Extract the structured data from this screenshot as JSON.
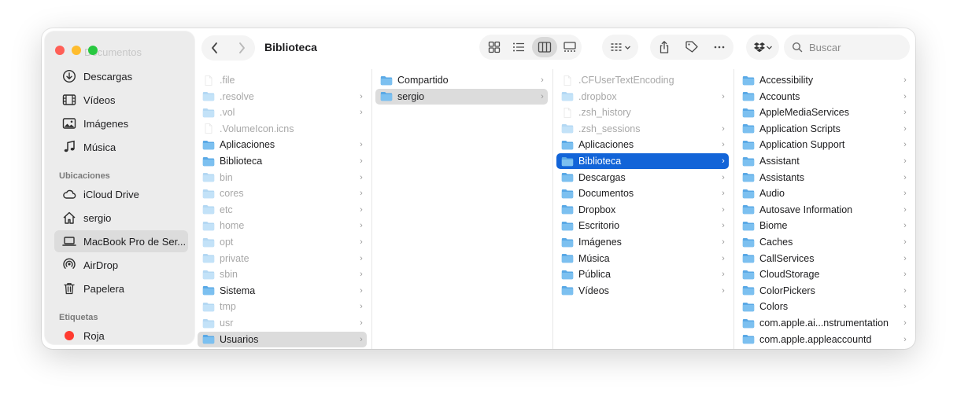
{
  "window": {
    "title": "Biblioteca",
    "ghost_text": "Documentos"
  },
  "toolbar": {
    "back_label": "‹",
    "forward_label": "›",
    "search_placeholder": "Buscar",
    "view_icons": [
      "grid-view-icon",
      "list-view-icon",
      "columns-view-icon",
      "gallery-view-icon"
    ],
    "active_view": "columns"
  },
  "sidebar": {
    "favorites": [
      {
        "label": "Descargas",
        "icon": "download-icon"
      },
      {
        "label": "Vídeos",
        "icon": "film-icon"
      },
      {
        "label": "Imágenes",
        "icon": "photo-icon"
      },
      {
        "label": "Música",
        "icon": "music-note-icon"
      }
    ],
    "locations_header": "Ubicaciones",
    "locations": [
      {
        "label": "iCloud Drive",
        "icon": "cloud-icon"
      },
      {
        "label": "sergio",
        "icon": "house-icon"
      },
      {
        "label": "MacBook Pro de Ser...",
        "icon": "laptop-icon",
        "selected": true
      },
      {
        "label": "AirDrop",
        "icon": "airdrop-icon"
      },
      {
        "label": "Papelera",
        "icon": "trash-icon"
      }
    ],
    "tags_header": "Etiquetas",
    "tags": [
      {
        "label": "Roja",
        "color": "#ff3b30"
      }
    ]
  },
  "columns": [
    {
      "items": [
        {
          "name": ".file",
          "kind": "file",
          "dim": true,
          "chevron": false
        },
        {
          "name": ".resolve",
          "kind": "folder",
          "dim": true,
          "chevron": true
        },
        {
          "name": ".vol",
          "kind": "folder",
          "dim": true,
          "chevron": true
        },
        {
          "name": ".VolumeIcon.icns",
          "kind": "file",
          "dim": true,
          "chevron": false
        },
        {
          "name": "Aplicaciones",
          "kind": "folder",
          "dim": false,
          "chevron": true
        },
        {
          "name": "Biblioteca",
          "kind": "folder",
          "dim": false,
          "chevron": true
        },
        {
          "name": "bin",
          "kind": "folder",
          "dim": true,
          "chevron": true
        },
        {
          "name": "cores",
          "kind": "folder",
          "dim": true,
          "chevron": true
        },
        {
          "name": "etc",
          "kind": "folder",
          "dim": true,
          "chevron": true
        },
        {
          "name": "home",
          "kind": "folder",
          "dim": true,
          "chevron": true
        },
        {
          "name": "opt",
          "kind": "folder",
          "dim": true,
          "chevron": true
        },
        {
          "name": "private",
          "kind": "folder",
          "dim": true,
          "chevron": true
        },
        {
          "name": "sbin",
          "kind": "folder",
          "dim": true,
          "chevron": true
        },
        {
          "name": "Sistema",
          "kind": "folder",
          "dim": false,
          "chevron": true
        },
        {
          "name": "tmp",
          "kind": "folder",
          "dim": true,
          "chevron": true
        },
        {
          "name": "usr",
          "kind": "folder",
          "dim": true,
          "chevron": true
        },
        {
          "name": "Usuarios",
          "kind": "folder",
          "dim": false,
          "chevron": true,
          "selected": "gray"
        }
      ]
    },
    {
      "items": [
        {
          "name": "Compartido",
          "kind": "folder",
          "dim": false,
          "chevron": true
        },
        {
          "name": "sergio",
          "kind": "folder",
          "dim": false,
          "chevron": true,
          "selected": "gray"
        }
      ]
    },
    {
      "items": [
        {
          "name": ".CFUserTextEncoding",
          "kind": "file",
          "dim": true,
          "chevron": false
        },
        {
          "name": ".dropbox",
          "kind": "folder",
          "dim": true,
          "chevron": true
        },
        {
          "name": ".zsh_history",
          "kind": "file",
          "dim": true,
          "chevron": false
        },
        {
          "name": ".zsh_sessions",
          "kind": "folder",
          "dim": true,
          "chevron": true
        },
        {
          "name": "Aplicaciones",
          "kind": "folder",
          "dim": false,
          "chevron": true
        },
        {
          "name": "Biblioteca",
          "kind": "folder",
          "dim": false,
          "chevron": true,
          "selected": "blue"
        },
        {
          "name": "Descargas",
          "kind": "folder",
          "dim": false,
          "chevron": true
        },
        {
          "name": "Documentos",
          "kind": "folder",
          "dim": false,
          "chevron": true
        },
        {
          "name": "Dropbox",
          "kind": "folder",
          "dim": false,
          "chevron": true
        },
        {
          "name": "Escritorio",
          "kind": "folder",
          "dim": false,
          "chevron": true
        },
        {
          "name": "Imágenes",
          "kind": "folder",
          "dim": false,
          "chevron": true
        },
        {
          "name": "Música",
          "kind": "folder",
          "dim": false,
          "chevron": true
        },
        {
          "name": "Pública",
          "kind": "folder",
          "dim": false,
          "chevron": true
        },
        {
          "name": "Vídeos",
          "kind": "folder",
          "dim": false,
          "chevron": true
        }
      ]
    },
    {
      "items": [
        {
          "name": "Accessibility",
          "kind": "folder",
          "dim": false,
          "chevron": true
        },
        {
          "name": "Accounts",
          "kind": "folder",
          "dim": false,
          "chevron": true
        },
        {
          "name": "AppleMediaServices",
          "kind": "folder",
          "dim": false,
          "chevron": true
        },
        {
          "name": "Application Scripts",
          "kind": "folder",
          "dim": false,
          "chevron": true
        },
        {
          "name": "Application Support",
          "kind": "folder",
          "dim": false,
          "chevron": true
        },
        {
          "name": "Assistant",
          "kind": "folder",
          "dim": false,
          "chevron": true
        },
        {
          "name": "Assistants",
          "kind": "folder",
          "dim": false,
          "chevron": true
        },
        {
          "name": "Audio",
          "kind": "folder",
          "dim": false,
          "chevron": true
        },
        {
          "name": "Autosave Information",
          "kind": "folder",
          "dim": false,
          "chevron": true
        },
        {
          "name": "Biome",
          "kind": "folder",
          "dim": false,
          "chevron": true
        },
        {
          "name": "Caches",
          "kind": "folder",
          "dim": false,
          "chevron": true
        },
        {
          "name": "CallServices",
          "kind": "folder",
          "dim": false,
          "chevron": true
        },
        {
          "name": "CloudStorage",
          "kind": "folder",
          "dim": false,
          "chevron": true
        },
        {
          "name": "ColorPickers",
          "kind": "folder",
          "dim": false,
          "chevron": true
        },
        {
          "name": "Colors",
          "kind": "folder",
          "dim": false,
          "chevron": true
        },
        {
          "name": "com.apple.ai...nstrumentation",
          "kind": "folder",
          "dim": false,
          "chevron": true
        },
        {
          "name": "com.apple.appleaccountd",
          "kind": "folder",
          "dim": false,
          "chevron": true
        }
      ]
    }
  ],
  "colors": {
    "folder": "#5aa9e6",
    "selection_blue": "#1264d8",
    "selection_gray": "#dcdcdc"
  }
}
